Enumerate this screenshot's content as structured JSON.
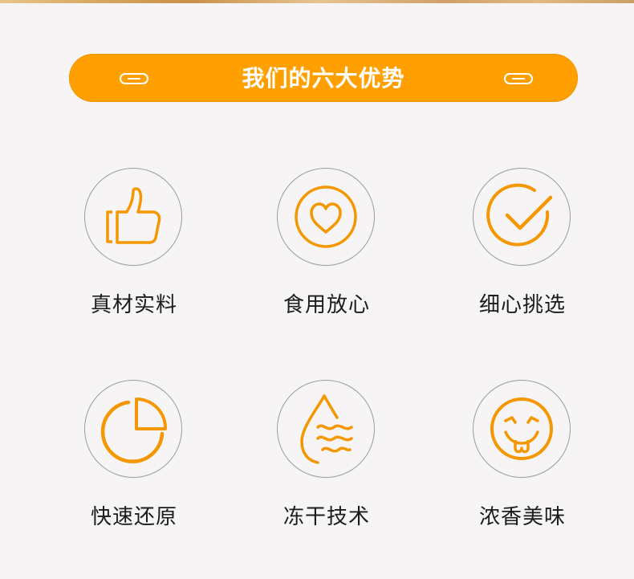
{
  "banner": {
    "title": "我们的六大优势"
  },
  "colors": {
    "accent": "#ffa000",
    "icon": "#f49700",
    "circle_border": "#9c9c9c",
    "text": "#1c1c1c",
    "background": "#f6f4f4"
  },
  "features": [
    {
      "label": "真材实料",
      "icon": "thumbs-up-icon"
    },
    {
      "label": "食用放心",
      "icon": "heart-icon"
    },
    {
      "label": "细心挑选",
      "icon": "checkmark-icon"
    },
    {
      "label": "快速还原",
      "icon": "pie-chart-icon"
    },
    {
      "label": "冻干技术",
      "icon": "water-drop-icon"
    },
    {
      "label": "浓香美味",
      "icon": "smiley-face-icon"
    }
  ]
}
